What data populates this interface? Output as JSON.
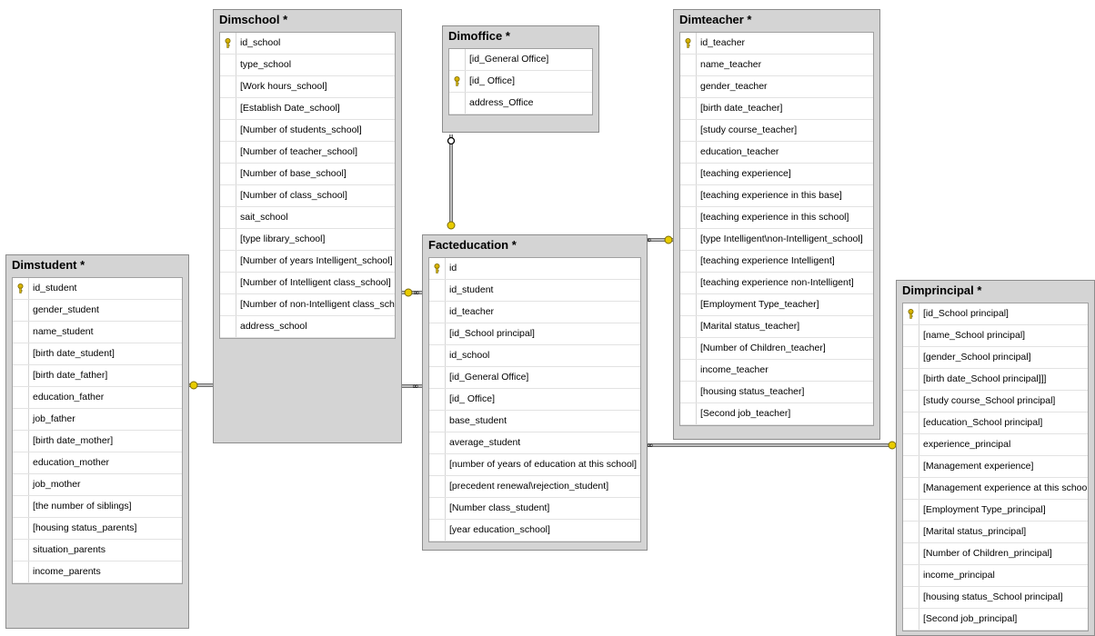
{
  "tables": {
    "dimschool": {
      "title": "Dimschool *",
      "columns": [
        {
          "name": "id_school",
          "key": true
        },
        {
          "name": "type_school"
        },
        {
          "name": "[Work hours_school]"
        },
        {
          "name": "[Establish Date_school]"
        },
        {
          "name": "[Number of students_school]"
        },
        {
          "name": "[Number of teacher_school]"
        },
        {
          "name": "[Number of base_school]"
        },
        {
          "name": "[Number of class_school]"
        },
        {
          "name": "sait_school"
        },
        {
          "name": "[type library_school]"
        },
        {
          "name": "[Number of years Intelligent_school]"
        },
        {
          "name": "[Number of Intelligent class_school]"
        },
        {
          "name": "[Number of non-Intelligent class_school]"
        },
        {
          "name": "address_school"
        }
      ]
    },
    "dimoffice": {
      "title": "Dimoffice *",
      "columns": [
        {
          "name": "[id_General Office]"
        },
        {
          "name": "[id_ Office]",
          "key": true
        },
        {
          "name": "address_Office"
        }
      ]
    },
    "dimteacher": {
      "title": "Dimteacher *",
      "columns": [
        {
          "name": "id_teacher",
          "key": true
        },
        {
          "name": "name_teacher"
        },
        {
          "name": "gender_teacher"
        },
        {
          "name": "[birth date_teacher]"
        },
        {
          "name": "[study course_teacher]"
        },
        {
          "name": "education_teacher"
        },
        {
          "name": "[teaching experience]"
        },
        {
          "name": "[teaching experience in this base]"
        },
        {
          "name": "[teaching experience in this school]"
        },
        {
          "name": "[type Intelligent\\non-Intelligent_school]"
        },
        {
          "name": "[teaching experience Intelligent]"
        },
        {
          "name": "[teaching experience non-Intelligent]"
        },
        {
          "name": "[Employment Type_teacher]"
        },
        {
          "name": "[Marital status_teacher]"
        },
        {
          "name": "[Number of Children_teacher]"
        },
        {
          "name": "income_teacher"
        },
        {
          "name": "[housing status_teacher]"
        },
        {
          "name": "[Second job_teacher]"
        }
      ]
    },
    "dimstudent": {
      "title": "Dimstudent *",
      "columns": [
        {
          "name": "id_student",
          "key": true
        },
        {
          "name": "gender_student"
        },
        {
          "name": "name_student"
        },
        {
          "name": "[birth date_student]"
        },
        {
          "name": "[birth date_father]"
        },
        {
          "name": "education_father"
        },
        {
          "name": "job_father"
        },
        {
          "name": "[birth date_mother]"
        },
        {
          "name": "education_mother"
        },
        {
          "name": "job_mother"
        },
        {
          "name": "[the number of siblings]"
        },
        {
          "name": "[housing status_parents]"
        },
        {
          "name": "situation_parents"
        },
        {
          "name": "income_parents"
        }
      ]
    },
    "facteducation": {
      "title": "Facteducation *",
      "columns": [
        {
          "name": "id",
          "key": true
        },
        {
          "name": "id_student"
        },
        {
          "name": "id_teacher"
        },
        {
          "name": "[id_School principal]"
        },
        {
          "name": "id_school"
        },
        {
          "name": "[id_General Office]"
        },
        {
          "name": "[id_ Office]"
        },
        {
          "name": "base_student"
        },
        {
          "name": "average_student"
        },
        {
          "name": "[number of years of education at this school]"
        },
        {
          "name": "[precedent renewal\\rejection_student]"
        },
        {
          "name": "[Number class_student]"
        },
        {
          "name": "[year education_school]"
        }
      ]
    },
    "dimprincipal": {
      "title": "Dimprincipal *",
      "columns": [
        {
          "name": "[id_School principal]",
          "key": true
        },
        {
          "name": "[name_School principal]"
        },
        {
          "name": "[gender_School principal]"
        },
        {
          "name": "[birth date_School principal]]]"
        },
        {
          "name": "[study course_School principal]"
        },
        {
          "name": "[education_School principal]"
        },
        {
          "name": "experience_principal"
        },
        {
          "name": "[Management experience]"
        },
        {
          "name": "[Management experience at this school]]]"
        },
        {
          "name": "[Employment Type_principal]"
        },
        {
          "name": "[Marital status_principal]"
        },
        {
          "name": "[Number of Children_principal]"
        },
        {
          "name": "income_principal"
        },
        {
          "name": "[housing status_School principal]"
        },
        {
          "name": "[Second job_principal]"
        }
      ]
    }
  },
  "colors": {
    "title_bar": "#d4d4d4",
    "grid_bg": "#ffffff",
    "link": "#7a7a7a",
    "key_gold": "#d8b300"
  }
}
